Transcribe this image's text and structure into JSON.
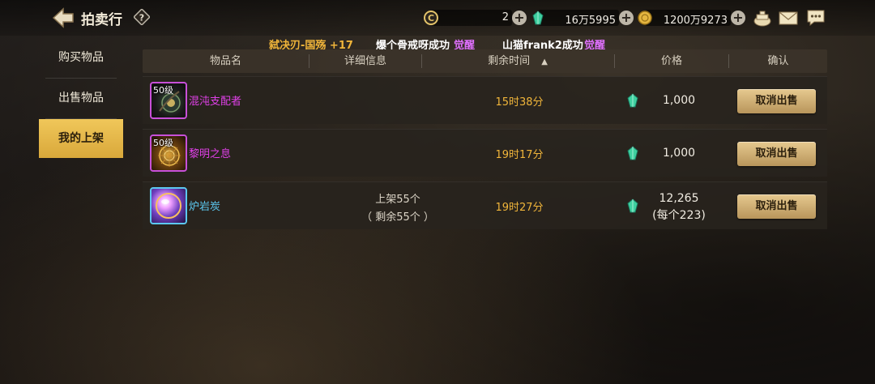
{
  "header": {
    "title": "拍卖行"
  },
  "currencies": [
    {
      "icon": "c-coin-icon",
      "value": "2"
    },
    {
      "icon": "green-gem-icon",
      "value": "16万5995"
    },
    {
      "icon": "gold-coin-icon",
      "value": "1200万9273"
    }
  ],
  "sidebar": {
    "items": [
      {
        "label": "购买物品"
      },
      {
        "label": "出售物品"
      },
      {
        "label": "我的上架",
        "active": true
      }
    ]
  },
  "broadcast": {
    "items": [
      {
        "text": "弑决刃-国殇 +17",
        "color": "#f0b53a"
      },
      {
        "text": "爆个骨戒呀成功",
        "suffix": "觉醒",
        "color": "#ffffff",
        "suffix_color": "#e070ff"
      },
      {
        "text": "山猫frank2成功",
        "suffix": "觉醒",
        "color": "#ffffff",
        "suffix_color": "#e070ff"
      }
    ]
  },
  "table": {
    "columns": [
      "物品名",
      "详细信息",
      "剩余时间",
      "价格",
      "确认"
    ],
    "sort_indicator": "▲",
    "rows": [
      {
        "level": "50级",
        "name": "混沌支配者",
        "name_color": "#e040e8",
        "detail_line1": "",
        "detail_line2": "",
        "time": "15时38分",
        "price": "1,000",
        "price_sub": "",
        "button": "取消出售"
      },
      {
        "level": "50级",
        "name": "黎明之息",
        "name_color": "#e040e8",
        "detail_line1": "",
        "detail_line2": "",
        "time": "19时17分",
        "price": "1,000",
        "price_sub": "",
        "button": "取消出售"
      },
      {
        "level": "",
        "name": "炉岩炭",
        "name_color": "#5cc8f0",
        "detail_line1": "上架55个",
        "detail_line2": "（ 剩余55个 ）",
        "time": "19时27分",
        "price": "12,265",
        "price_sub": "(每个223)",
        "button": "取消出售"
      }
    ]
  },
  "colors": {
    "accent": "#f0c75a",
    "time": "#f0b53a",
    "epic": "#e040e8",
    "rare": "#5cc8f0"
  }
}
